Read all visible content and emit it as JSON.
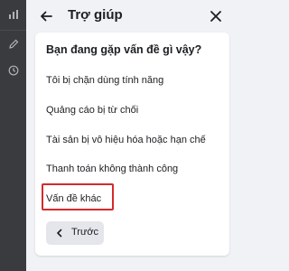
{
  "header": {
    "title": "Trợ giúp",
    "back_icon": "arrow-left-icon",
    "close_icon": "close-icon"
  },
  "sidebar": {
    "icons": [
      "bar-chart-icon",
      "pencil-icon",
      "clock-icon"
    ]
  },
  "card": {
    "question": "Bạn đang gặp vấn đề gì vậy?",
    "options": [
      "Tôi bị chặn dùng tính năng",
      "Quảng cáo bị từ chối",
      "Tài sản bị vô hiệu hóa hoặc hạn chế",
      "Thanh toán không thành công",
      "Vấn đề khác"
    ],
    "prev_button": "Trước"
  },
  "colors": {
    "rail": "#3a3b3f",
    "panel_bg": "#f0f2f5",
    "card_bg": "#ffffff",
    "highlight": "#d42b2b",
    "button_bg": "#e4e6eb"
  }
}
